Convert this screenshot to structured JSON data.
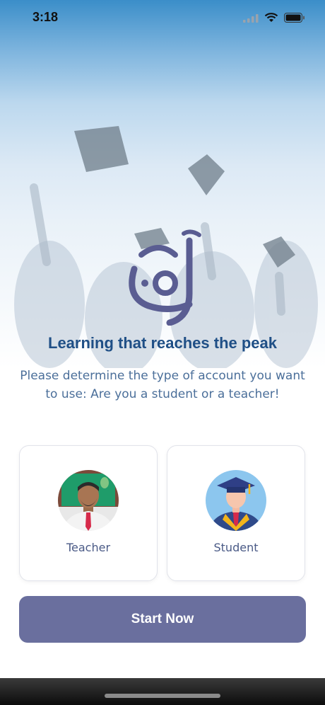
{
  "status_bar": {
    "time": "3:18"
  },
  "hero": {
    "headline": "Learning that reaches the peak",
    "prompt": "Please determine the type of account you want to use: Are you a student or a teacher!"
  },
  "account_types": [
    {
      "label": "Teacher",
      "icon": "teacher-icon"
    },
    {
      "label": "Student",
      "icon": "student-icon"
    }
  ],
  "actions": {
    "start_label": "Start Now"
  },
  "colors": {
    "headline": "#1f4f86",
    "prompt": "#4b6f9a",
    "button": "#6a6f9e",
    "card_label": "#4a5a86"
  }
}
